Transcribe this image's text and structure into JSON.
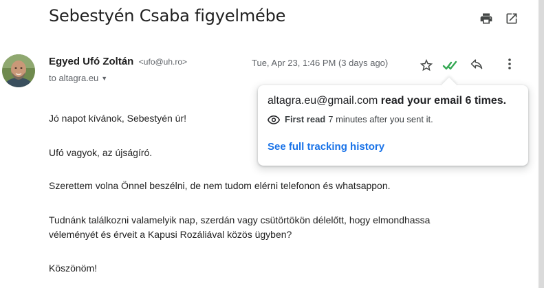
{
  "email": {
    "subject": "Sebestyén Csaba figyelmébe",
    "sender_name": "Egyed Ufó Zoltán",
    "sender_email": "<ufo@uh.ro>",
    "to": "to altagra.eu",
    "date": "Tue, Apr 23, 1:46 PM (3 days ago)",
    "body": [
      "Jó napot kívánok, Sebestyén úr!",
      "Ufó vagyok, az újságíró.",
      "Szerettem volna Önnel beszélni, de nem tudom elérni telefonon és whatsappon.",
      "Tudnánk találkozni valamelyik nap, szerdán vagy csütörtökön délelőtt, hogy elmondhassa",
      "véleményét és érveit a Kapusi Rozáliával közös ügyben?",
      "Köszönöm!"
    ]
  },
  "tracking_popover": {
    "reader": "altagra.eu@gmail.com",
    "read_text": "read your email 6 times.",
    "first_read_label": "First read",
    "first_read_detail": "7 minutes after you sent it.",
    "link": "See full tracking history"
  },
  "icons": {
    "print": "print-icon",
    "popout": "open-in-new-window-icon",
    "star": "star-icon",
    "read_receipt": "double-check-icon",
    "reply": "reply-icon",
    "more": "more-vert-icon",
    "eye": "eye-icon"
  },
  "colors": {
    "check": "#34a853",
    "link": "#1a73e8"
  }
}
